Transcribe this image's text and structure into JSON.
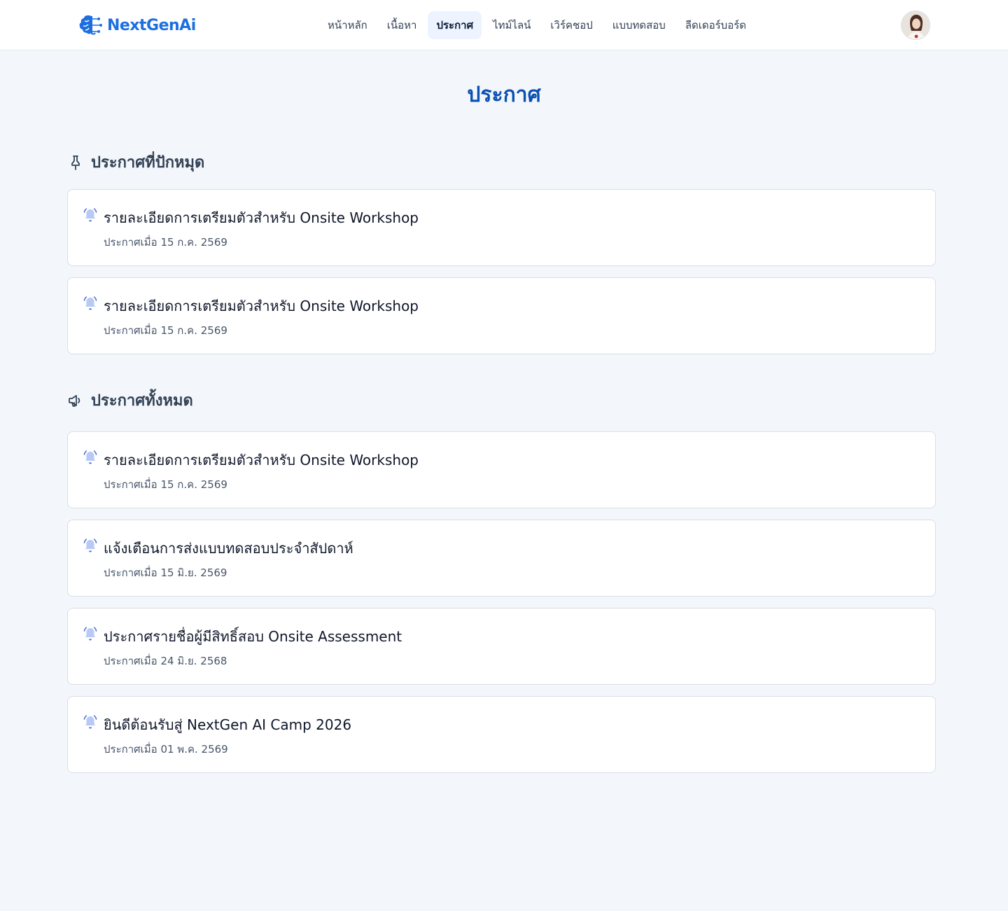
{
  "brand": {
    "name": "NextGenAi",
    "accent": "#1d6fe0"
  },
  "nav": {
    "items": [
      {
        "label": "หน้าหลัก",
        "active": false
      },
      {
        "label": "เนื้อหา",
        "active": false
      },
      {
        "label": "ประกาศ",
        "active": true
      },
      {
        "label": "ไทม์ไลน์",
        "active": false
      },
      {
        "label": "เวิร์คชอป",
        "active": false
      },
      {
        "label": "แบบทดสอบ",
        "active": false
      },
      {
        "label": "ลีดเดอร์บอร์ด",
        "active": false
      }
    ]
  },
  "page": {
    "title": "ประกาศ"
  },
  "pinned": {
    "heading": "ประกาศที่ปักหมุด",
    "icon": "pin-icon",
    "items": [
      {
        "title": "รายละเอียดการเตรียมตัวสำหรับ Onsite Workshop",
        "date": "ประกาศเมื่อ 15 ก.ค. 2569"
      },
      {
        "title": "รายละเอียดการเตรียมตัวสำหรับ Onsite Workshop",
        "date": "ประกาศเมื่อ 15 ก.ค. 2569"
      }
    ]
  },
  "all": {
    "heading": "ประกาศทั้งหมด",
    "icon": "megaphone-icon",
    "items": [
      {
        "title": "รายละเอียดการเตรียมตัวสำหรับ Onsite Workshop",
        "date": "ประกาศเมื่อ 15 ก.ค. 2569"
      },
      {
        "title": "แจ้งเตือนการส่งแบบทดสอบประจำสัปดาห์",
        "date": "ประกาศเมื่อ 15 มิ.ย. 2569"
      },
      {
        "title": "ประกาศรายชื่อผู้มีสิทธิ์สอบ Onsite Assessment",
        "date": "ประกาศเมื่อ 24 มิ.ย. 2568"
      },
      {
        "title": "ยินดีต้อนรับสู่ NextGen AI Camp 2026",
        "date": "ประกาศเมื่อ 01 พ.ค. 2569"
      }
    ]
  }
}
